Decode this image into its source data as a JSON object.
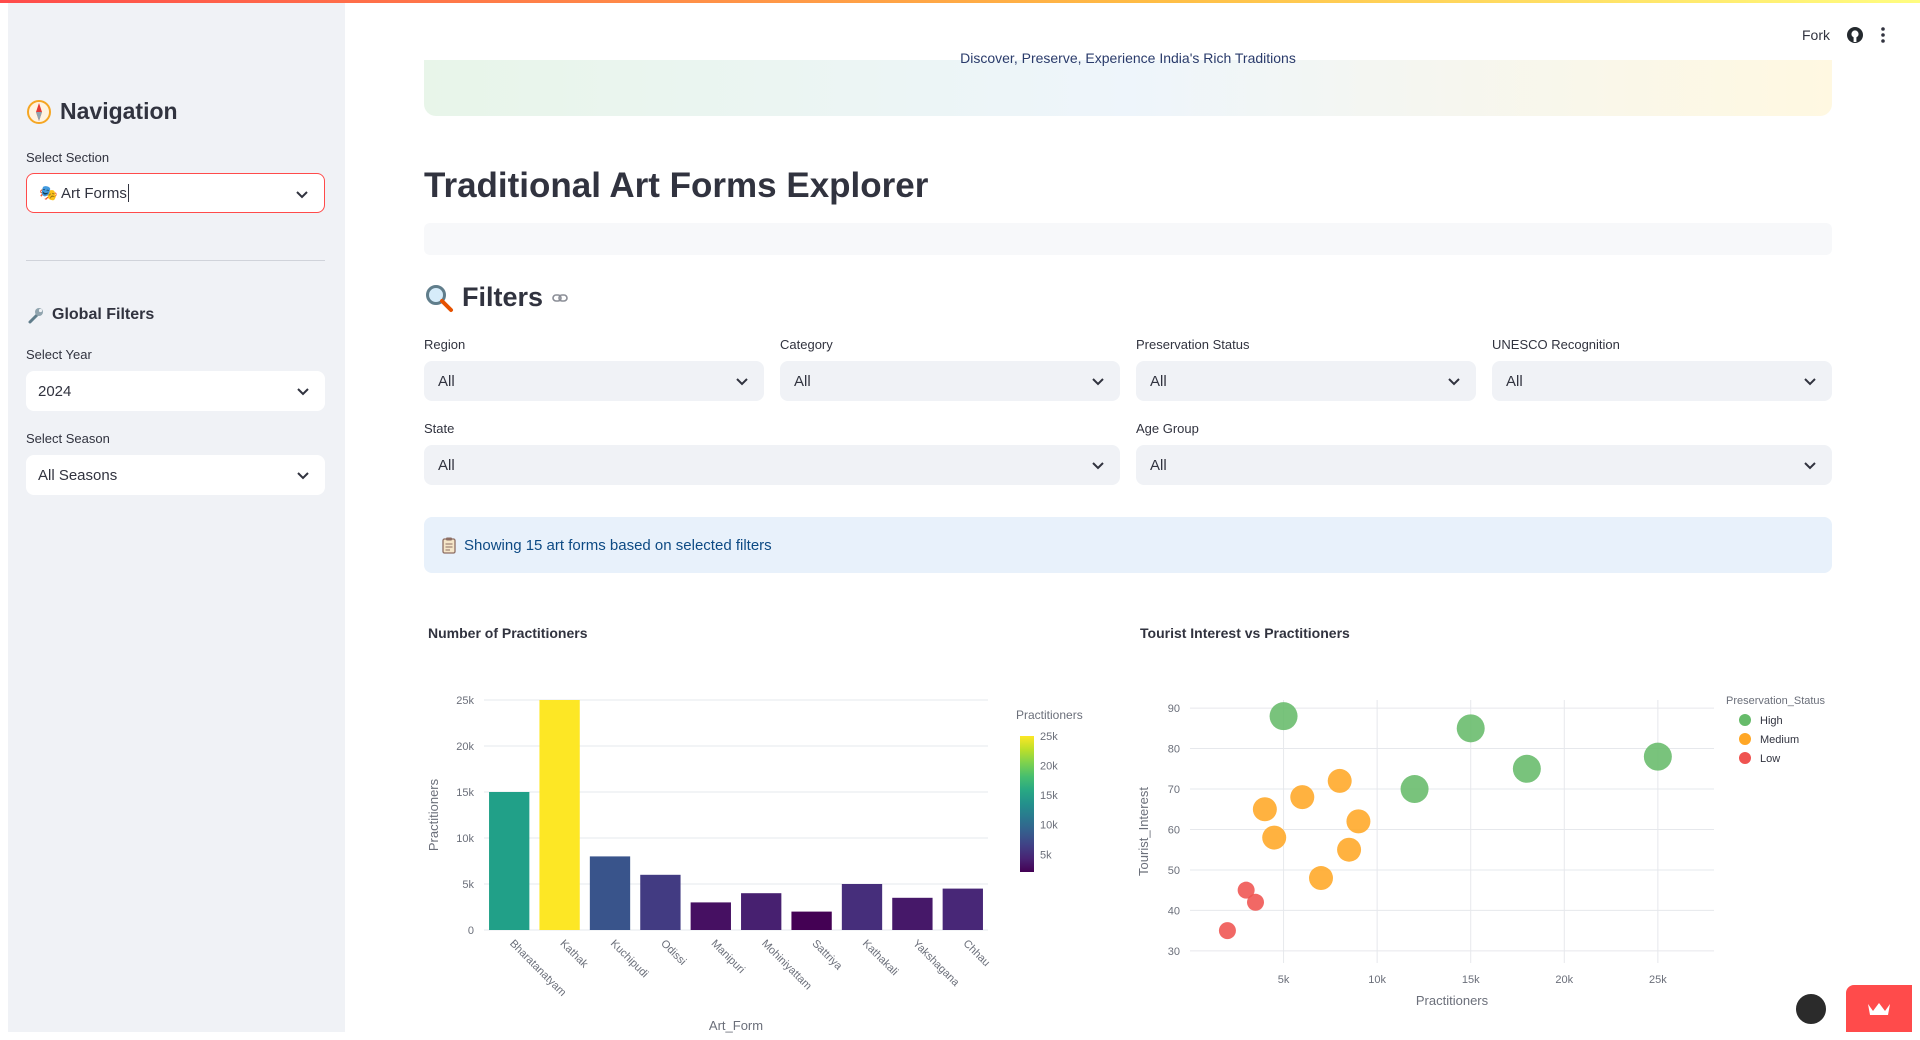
{
  "header": {
    "fork_label": "Fork"
  },
  "sidebar": {
    "nav_title": "Navigation",
    "section_label": "Select Section",
    "section_value": "🎭 Art Forms",
    "global_filters_title": "Global Filters",
    "year_label": "Select Year",
    "year_value": "2024",
    "season_label": "Select Season",
    "season_value": "All Seasons"
  },
  "banner": {
    "text": "Discover, Preserve, Experience India's Rich Traditions"
  },
  "main": {
    "page_title": "Traditional Art Forms Explorer",
    "filters_title": "Filters",
    "filters": {
      "region": {
        "label": "Region",
        "value": "All"
      },
      "category": {
        "label": "Category",
        "value": "All"
      },
      "preservation": {
        "label": "Preservation Status",
        "value": "All"
      },
      "unesco": {
        "label": "UNESCO Recognition",
        "value": "All"
      },
      "state": {
        "label": "State",
        "value": "All"
      },
      "age_group": {
        "label": "Age Group",
        "value": "All"
      }
    },
    "info_text": "Showing 15 art forms based on selected filters"
  },
  "colors": {
    "accent": "#ff4b4b",
    "high": "#66bb6a",
    "medium": "#ffa726",
    "low": "#ef5350"
  },
  "chart_data": [
    {
      "type": "bar",
      "title": "Number of Practitioners",
      "xlabel": "Art_Form",
      "ylabel": "Practitioners",
      "ylim": [
        0,
        25000
      ],
      "yticks": [
        0,
        5000,
        10000,
        15000,
        20000,
        25000
      ],
      "ytick_labels": [
        "0",
        "5k",
        "10k",
        "15k",
        "20k",
        "25k"
      ],
      "categories": [
        "Bharatanatyam",
        "Kathak",
        "Kuchipudi",
        "Odissi",
        "Manipuri",
        "Mohiniyattam",
        "Sattriya",
        "Kathakali",
        "Yakshagana",
        "Chhau"
      ],
      "values": [
        15000,
        25000,
        8000,
        6000,
        3000,
        4000,
        2000,
        5000,
        3500,
        4500
      ],
      "colorbar": {
        "title": "Practitioners",
        "tick_labels": [
          "5k",
          "10k",
          "15k",
          "20k",
          "25k"
        ],
        "ticks": [
          5000,
          10000,
          15000,
          20000,
          25000
        ]
      },
      "grid": true
    },
    {
      "type": "scatter",
      "title": "Tourist Interest vs Practitioners",
      "xlabel": "Practitioners",
      "ylabel": "Tourist_Interest",
      "xlim": [
        0,
        28000
      ],
      "ylim": [
        27,
        92
      ],
      "xticks": [
        5000,
        10000,
        15000,
        20000,
        25000
      ],
      "xtick_labels": [
        "5k",
        "10k",
        "15k",
        "20k",
        "25k"
      ],
      "yticks": [
        30,
        40,
        50,
        60,
        70,
        80,
        90
      ],
      "ytick_labels": [
        "30",
        "40",
        "50",
        "60",
        "70",
        "80",
        "90"
      ],
      "legend_title": "Preservation_Status",
      "legend_position": "top-right",
      "series": [
        {
          "name": "High",
          "color": "#66bb6a",
          "size": "large",
          "points": [
            [
              5000,
              88
            ],
            [
              15000,
              85
            ],
            [
              18000,
              75
            ],
            [
              25000,
              78
            ],
            [
              12000,
              70
            ]
          ]
        },
        {
          "name": "Medium",
          "color": "#ffa726",
          "size": "medium",
          "points": [
            [
              4000,
              65
            ],
            [
              6000,
              68
            ],
            [
              8000,
              72
            ],
            [
              4500,
              58
            ],
            [
              9000,
              62
            ],
            [
              8500,
              55
            ],
            [
              7000,
              48
            ]
          ]
        },
        {
          "name": "Low",
          "color": "#ef5350",
          "size": "small",
          "points": [
            [
              3000,
              45
            ],
            [
              3500,
              42
            ],
            [
              2000,
              35
            ]
          ]
        }
      ],
      "grid": true
    }
  ]
}
